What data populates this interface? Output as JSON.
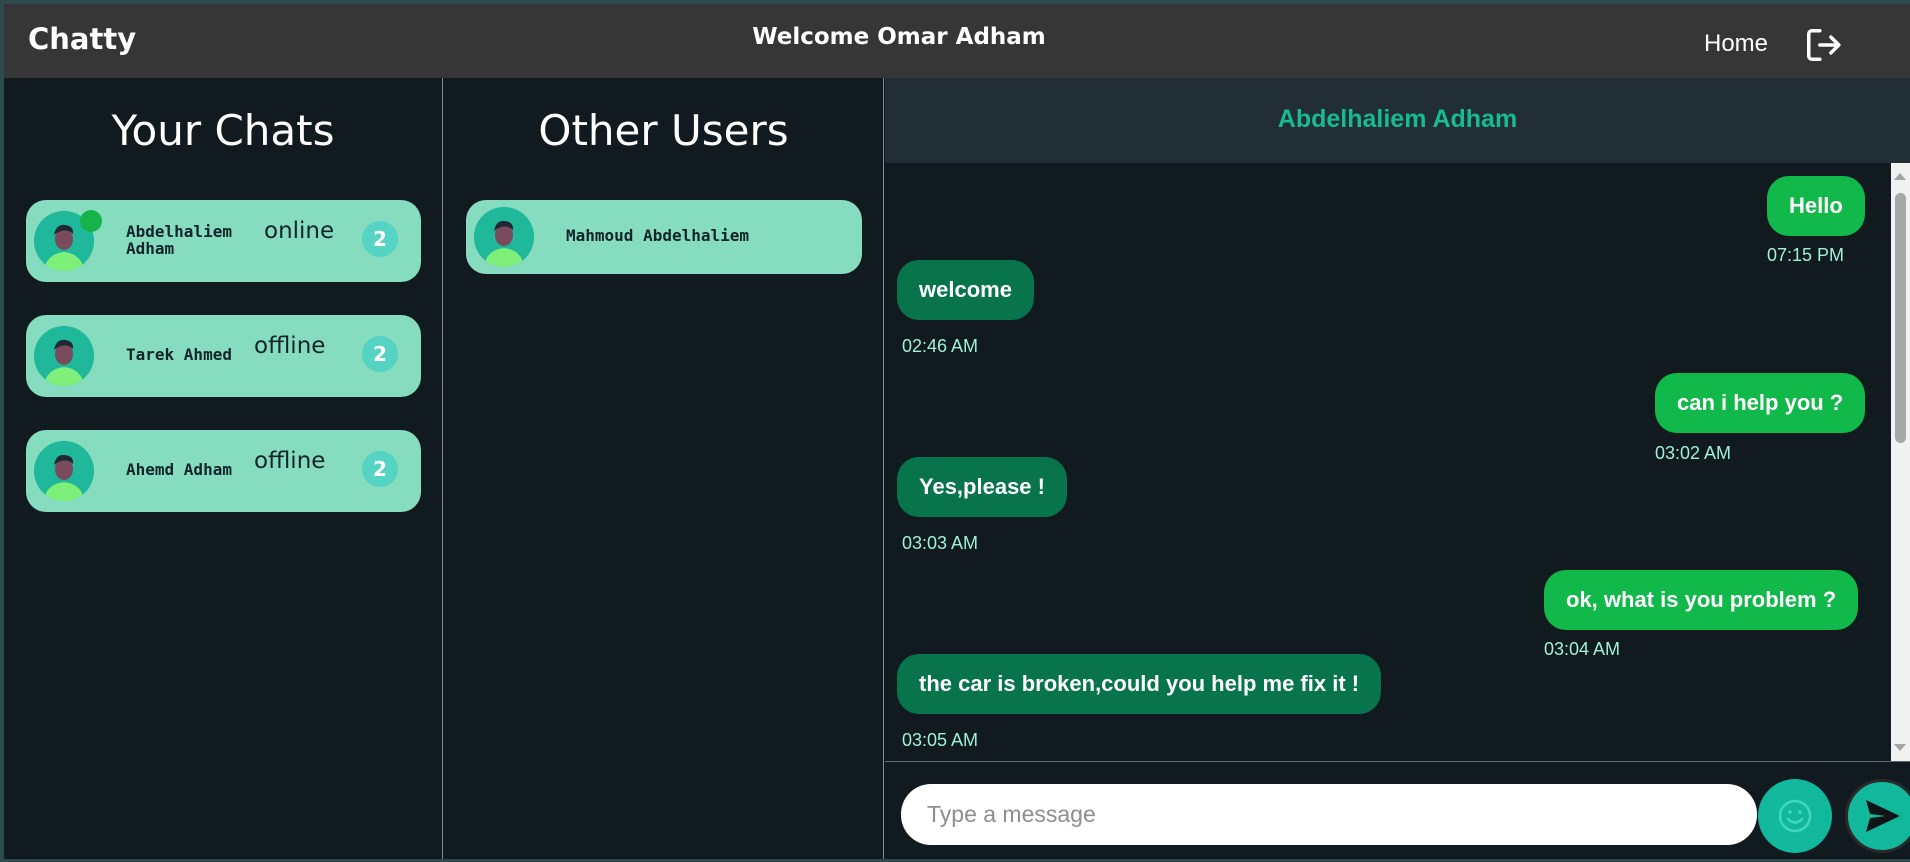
{
  "header": {
    "brand": "Chatty",
    "welcome": "Welcome Omar Adham",
    "home_label": "Home",
    "logout_icon": "logout-icon"
  },
  "chats": {
    "title": "Your Chats",
    "items": [
      {
        "name": "Abdelhaliem Adham",
        "status": "online",
        "unread": "2"
      },
      {
        "name": "Tarek Ahmed",
        "status": "offline",
        "unread": "2"
      },
      {
        "name": "Ahemd Adham",
        "status": "offline",
        "unread": "2"
      }
    ]
  },
  "users": {
    "title": "Other Users",
    "items": [
      {
        "name": "Mahmoud Abdelhaliem"
      }
    ]
  },
  "conversation": {
    "contact_name": "Abdelhaliem Adham",
    "messages": [
      {
        "direction": "out",
        "text": "Hello",
        "time": "07:15 PM"
      },
      {
        "direction": "in",
        "text": "welcome",
        "time": "02:46 AM"
      },
      {
        "direction": "out",
        "text": "can i help you ?",
        "time": "03:02 AM"
      },
      {
        "direction": "in",
        "text": "Yes,please !",
        "time": "03:03 AM"
      },
      {
        "direction": "out",
        "text": "ok, what is you problem ?",
        "time": "03:04 AM"
      },
      {
        "direction": "in",
        "text": "the car is broken,could you help me fix it !",
        "time": "03:05 AM"
      }
    ],
    "input_placeholder": "Type a message",
    "input_value": ""
  },
  "colors": {
    "header_bg": "#363636",
    "card_bg": "#86dcbe",
    "accent": "#12b89b",
    "outgoing_bubble": "#11b84a",
    "incoming_bubble": "#08744c"
  }
}
